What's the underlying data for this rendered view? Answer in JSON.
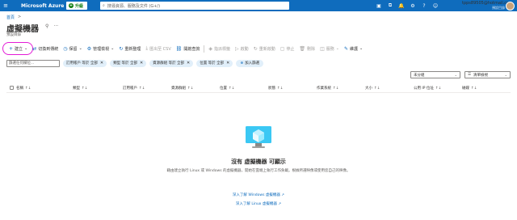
{
  "topbar": {
    "menu_icon": "hamburger-icon",
    "brand": "Microsoft Azure",
    "upgrade_label": "升級",
    "search_placeholder": "搜尋資源、服務及文件 (G+/)",
    "icons": [
      "cloud-shell-icon",
      "directory-filter-icon",
      "notifications-icon",
      "settings-icon",
      "help-icon",
      "feedback-icon"
    ],
    "account_email": "tpps89505@hotmail.com",
    "account_directory": "預設目錄"
  },
  "breadcrumb": {
    "home": "首頁",
    "separator": ">"
  },
  "page": {
    "title": "虛擬機器",
    "subtitle": "預設目錄"
  },
  "toolbar": {
    "items": [
      {
        "label": "建立",
        "icon": "+",
        "disabled": false,
        "chevron": true
      },
      {
        "label": "切換到傳統",
        "icon": "⇄",
        "disabled": false,
        "chevron": false
      },
      {
        "label": "保留",
        "icon": "◷",
        "disabled": false,
        "chevron": true
      },
      {
        "label": "管理檢視",
        "icon": "⚙",
        "disabled": false,
        "chevron": true
      },
      {
        "label": "重新整理",
        "icon": "↻",
        "disabled": false,
        "chevron": false
      },
      {
        "label": "匯出至 CSV",
        "icon": "⤓",
        "disabled": true,
        "chevron": false
      },
      {
        "label": "開啟查詢",
        "icon": "⛓",
        "disabled": false,
        "chevron": false
      },
      {
        "label": "指派標籤",
        "icon": "◈",
        "disabled": true,
        "chevron": false
      },
      {
        "label": "啟動",
        "icon": "▷",
        "disabled": true,
        "chevron": false
      },
      {
        "label": "重新啟動",
        "icon": "↻",
        "disabled": true,
        "chevron": false
      },
      {
        "label": "停止",
        "icon": "▢",
        "disabled": true,
        "chevron": false
      },
      {
        "label": "刪除",
        "icon": "🗑",
        "disabled": true,
        "chevron": false
      },
      {
        "label": "服務",
        "icon": "◫",
        "disabled": true,
        "chevron": true
      },
      {
        "label": "維護",
        "icon": "✎",
        "disabled": false,
        "chevron": true
      }
    ]
  },
  "filters": {
    "input_placeholder": "篩選任何欄位...",
    "pills": [
      {
        "label": "訂用帳戶 等於 全部"
      },
      {
        "label": "類型 等於 全部"
      },
      {
        "label": "資源群組 等於 全部"
      },
      {
        "label": "位置 等於 全部"
      }
    ],
    "add_filter_label": "加入篩選"
  },
  "view": {
    "grouping": "未分組",
    "list_view": "清單檢視"
  },
  "table": {
    "columns": [
      "名稱",
      "類型",
      "訂用帳戶",
      "資源群組",
      "位置",
      "狀態",
      "作業系統",
      "大小",
      "公用 IP 位址",
      "磁碟"
    ]
  },
  "empty_state": {
    "icon": "virtual-machine-icon",
    "title": "沒有 虛擬機器 可顯示",
    "description": "藉由建立執行 Linux 或 Windows 的虛擬機器，開始在雲端上執行工作負載。根據所選映像或使用您自己的映像。",
    "links": [
      "深入了解 Windows 虛擬機器 ↗",
      "深入了解 Linux 虛擬機器 ↗"
    ]
  }
}
